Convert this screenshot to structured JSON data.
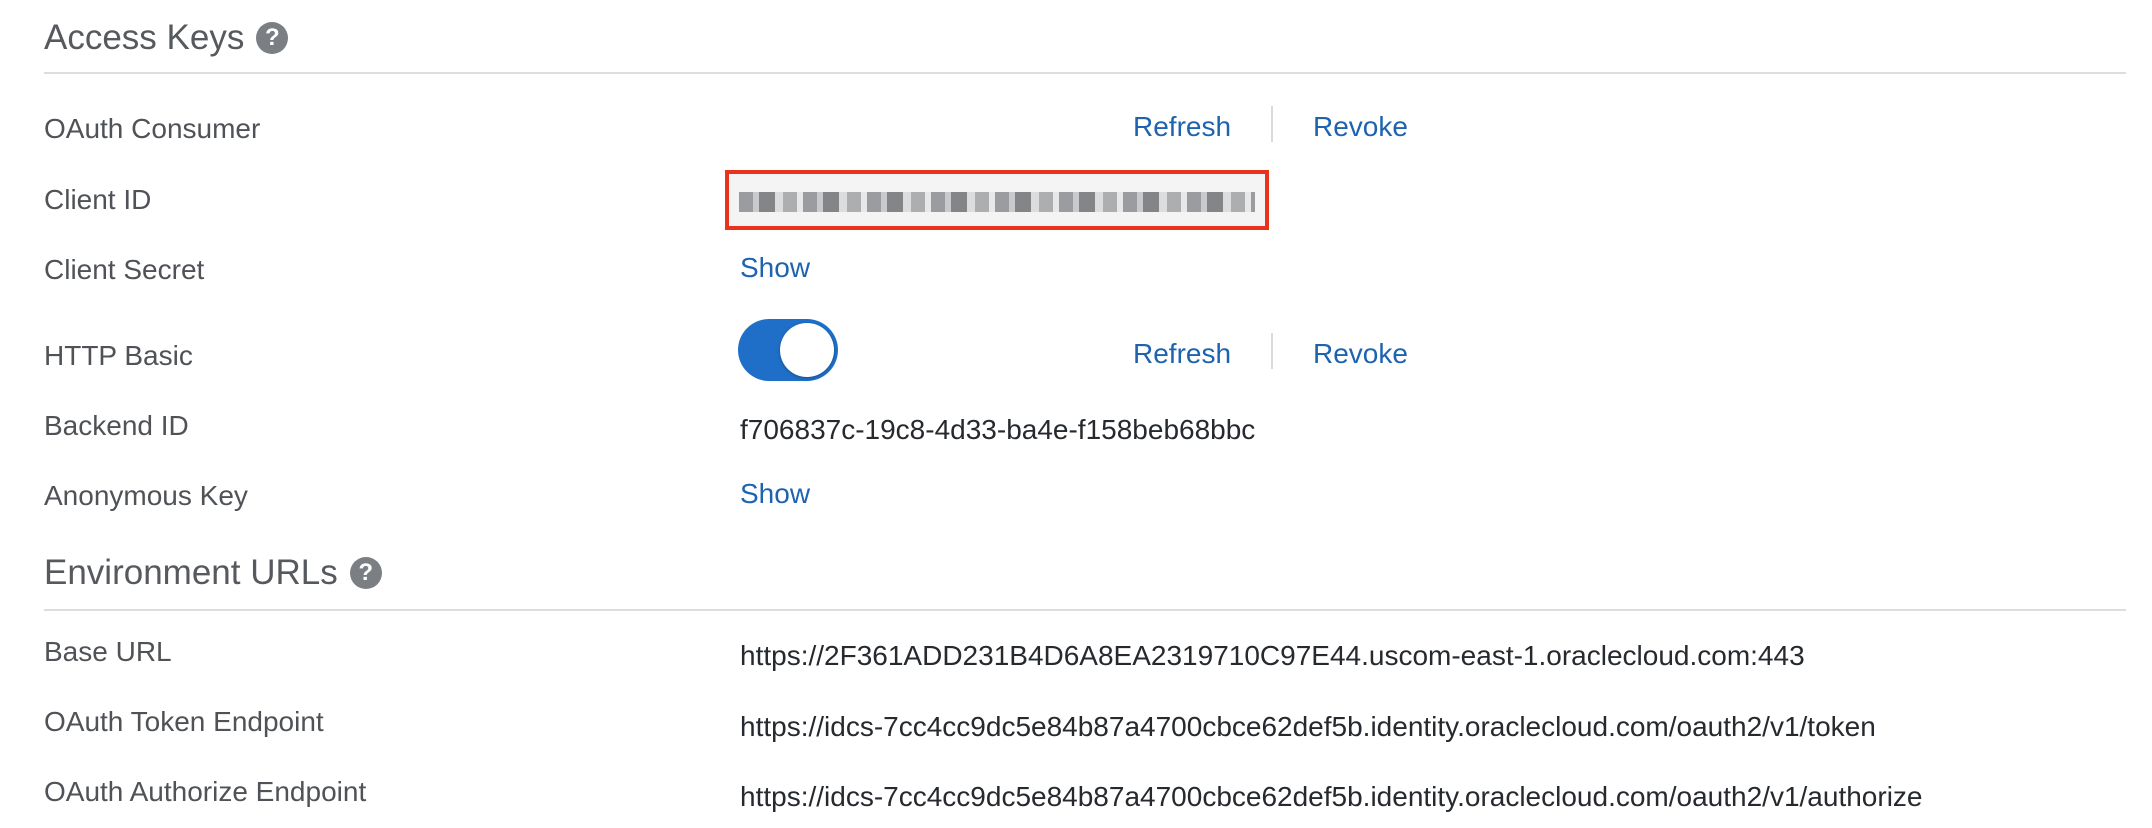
{
  "access_keys": {
    "title": "Access Keys",
    "help_glyph": "?",
    "oauth_consumer": {
      "label": "OAuth Consumer",
      "refresh": "Refresh",
      "revoke": "Revoke"
    },
    "client_id": {
      "label": "Client ID",
      "value_redacted": true
    },
    "client_secret": {
      "label": "Client Secret",
      "action": "Show"
    },
    "http_basic": {
      "label": "HTTP Basic",
      "toggle_on": true,
      "refresh": "Refresh",
      "revoke": "Revoke"
    },
    "backend_id": {
      "label": "Backend ID",
      "value": "f706837c-19c8-4d33-ba4e-f158beb68bbc"
    },
    "anonymous_key": {
      "label": "Anonymous Key",
      "action": "Show"
    }
  },
  "environment_urls": {
    "title": "Environment URLs",
    "help_glyph": "?",
    "base_url": {
      "label": "Base URL",
      "value": "https://2F361ADD231B4D6A8EA2319710C97E44.uscom-east-1.oraclecloud.com:443"
    },
    "oauth_token_endpoint": {
      "label": "OAuth Token Endpoint",
      "value": "https://idcs-7cc4cc9dc5e84b87a4700cbce62def5b.identity.oraclecloud.com/oauth2/v1/token"
    },
    "oauth_authorize_endpoint": {
      "label": "OAuth Authorize Endpoint",
      "value": "https://idcs-7cc4cc9dc5e84b87a4700cbce62def5b.identity.oraclecloud.com/oauth2/v1/authorize"
    }
  },
  "colors": {
    "link": "#1e63b0",
    "toggle_on": "#1f6fc9",
    "highlight_border": "#e8341f",
    "help_icon": "#7b7e82"
  }
}
